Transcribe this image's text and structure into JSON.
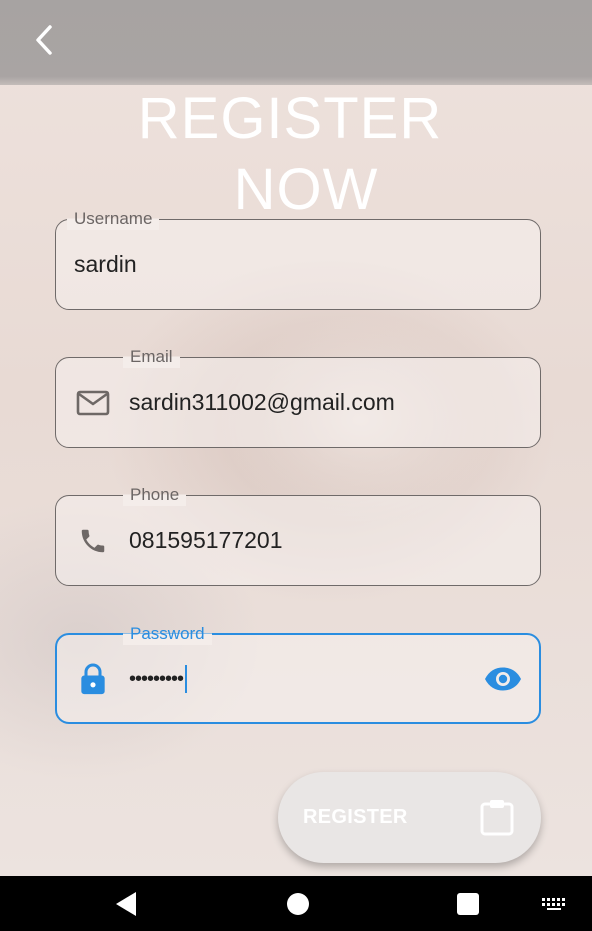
{
  "header": {
    "back_icon": "chevron-left-icon",
    "title_line1": "REGISTER",
    "title_line2": "NOW"
  },
  "form": {
    "username": {
      "label": "Username",
      "value": "sardin"
    },
    "email": {
      "label": "Email",
      "value": "sardin311002@gmail.com",
      "icon": "mail-icon"
    },
    "phone": {
      "label": "Phone",
      "value": "081595177201",
      "icon": "phone-icon"
    },
    "password": {
      "label": "Password",
      "value": "•••••••••",
      "icon": "lock-icon",
      "toggle_icon": "eye-icon"
    }
  },
  "register_button": {
    "label": "REGISTER",
    "icon": "clipboard-icon"
  },
  "system_nav": {
    "back": "triangle-back-icon",
    "home": "circle-home-icon",
    "recents": "square-recents-icon",
    "keyboard": "keyboard-icon"
  },
  "colors": {
    "accent": "#2a8de0",
    "appbar": "#a9a4a3",
    "field_border": "#6f6a69"
  }
}
